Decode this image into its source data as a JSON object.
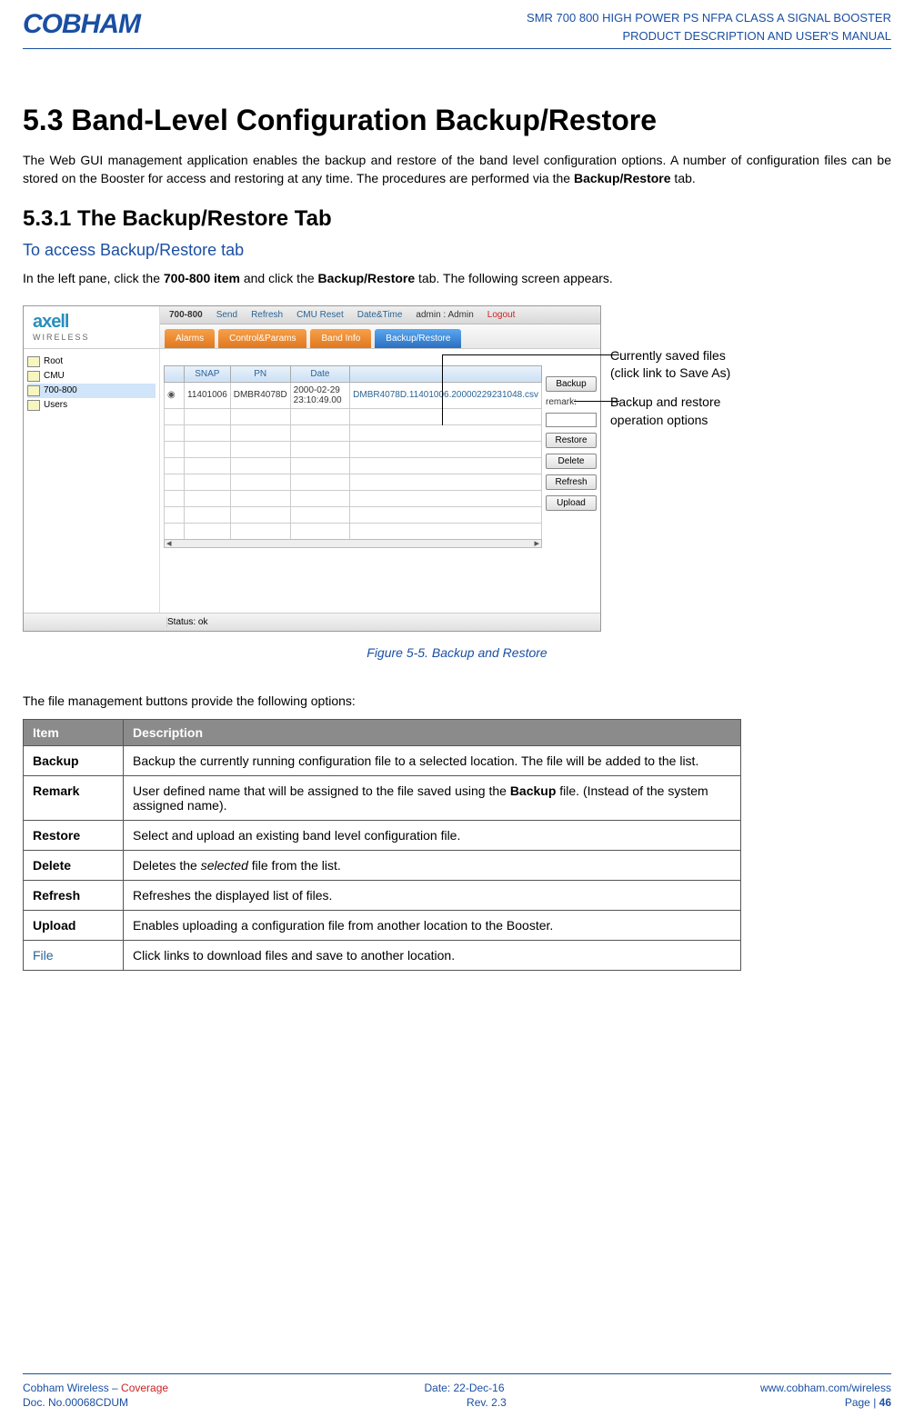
{
  "header": {
    "logo": "COBHAM",
    "line1": "SMR 700 800 HIGH POWER PS NFPA CLASS A SIGNAL BOOSTER",
    "line2": "PRODUCT DESCRIPTION AND USER'S MANUAL"
  },
  "sections": {
    "h1": "5.3   Band-Level Configuration Backup/Restore",
    "intro": "The Web GUI management application enables the backup and restore of the band level configuration options. A number of configuration files can be stored on the Booster for access and restoring at any time. The procedures are performed via the ",
    "intro_bold": "Backup/Restore",
    "intro_tail": " tab.",
    "h2": "5.3.1   The Backup/Restore Tab",
    "access": "To access Backup/Restore tab",
    "instr_pre": "In the left pane, click the ",
    "instr_b1": "700-800 item",
    "instr_mid": " and click the ",
    "instr_b2": "Backup/Restore",
    "instr_tail": " tab. The following screen appears."
  },
  "screenshot": {
    "breadcrumb_title": "700-800",
    "top_links": [
      "Send",
      "Refresh",
      "CMU Reset",
      "Date&Time"
    ],
    "admin_label": "admin : Admin",
    "logout": "Logout",
    "tabs": [
      "Alarms",
      "Control&Params",
      "Band Info",
      "Backup/Restore"
    ],
    "tree": [
      "Root",
      "CMU",
      "700-800",
      "Users"
    ],
    "grid_headers": [
      "",
      "SNAP",
      "PN",
      "Date",
      ""
    ],
    "row": {
      "snap": "11401006",
      "pn": "DMBR4078D",
      "date": "2000-02-29 23:10:49.00",
      "file": "DMBR4078D.11401006.20000229231048.csv"
    },
    "side": {
      "backup": "Backup",
      "remark_label": "remark:",
      "remark_value": "",
      "restore": "Restore",
      "delete": "Delete",
      "refresh": "Refresh",
      "upload": "Upload"
    },
    "status": "Status: ok",
    "logo1": "axell",
    "logo2": "WIRELESS"
  },
  "callouts": {
    "c1a": "Currently saved files",
    "c1b": "(click link to Save As)",
    "c2a": "Backup and restore",
    "c2b": "operation options"
  },
  "figcaption": "Figure 5-5. Backup and Restore",
  "table_intro": "The file management buttons provide the following options:",
  "table": {
    "head_item": "Item",
    "head_desc": "Description",
    "rows": [
      {
        "item": "Backup",
        "desc": "Backup the currently running configuration file to a selected location. The file will be added to the list."
      },
      {
        "item": "Remark",
        "desc_pre": "User defined name that will be assigned to the file saved using the ",
        "desc_b": "Backup",
        "desc_post": " file. (Instead of the system assigned name)."
      },
      {
        "item": "Restore",
        "desc": "Select and upload an existing band level configuration file."
      },
      {
        "item": "Delete",
        "desc_pre": "Deletes the ",
        "desc_i": "selected",
        "desc_post": " file from the list."
      },
      {
        "item": "Refresh",
        "desc": "Refreshes the displayed list of files."
      },
      {
        "item": "Upload",
        "desc": "Enables uploading a configuration file from another location to the Booster."
      },
      {
        "item": "File",
        "link": true,
        "desc": "Click links to download files and save to another location."
      }
    ]
  },
  "footer": {
    "l1a_pre": "Cobham Wireless – ",
    "l1a_cov": "Coverage",
    "l1b": "Date: 22-Dec-16",
    "l1c": "www.cobham.com/wireless",
    "l2a": "Doc. No.00068CDUM",
    "l2b": "Rev. 2.3",
    "l2c_pre": "Page | ",
    "l2c_num": "46"
  }
}
